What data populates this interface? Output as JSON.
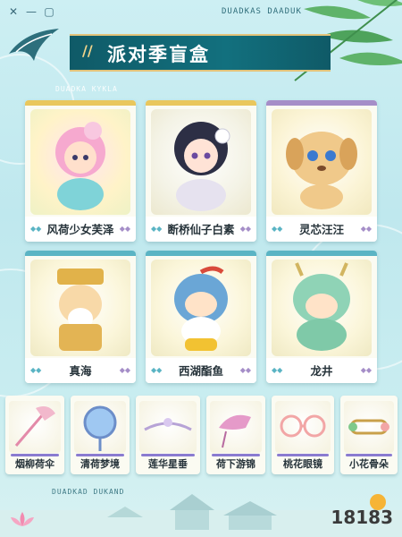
{
  "header": {
    "title": "派对季盲盒",
    "brand_text": "DUADKAS DAADUK",
    "brand_text_small": "DUADKA KYKLA",
    "brand_text_bottom": "DUADKAD DUKAND"
  },
  "featured_items": [
    {
      "name": "风荷少女芙泽",
      "stripe_color": "#e9c75d"
    },
    {
      "name": "断桥仙子白素",
      "stripe_color": "#e9c75d"
    },
    {
      "name": "灵芯汪汪",
      "stripe_color": "#a58ec8"
    },
    {
      "name": "真海",
      "stripe_color": "#5ab4c4"
    },
    {
      "name": "西湖酯鱼",
      "stripe_color": "#5ab4c4"
    },
    {
      "name": "龙井",
      "stripe_color": "#5ab4c4"
    }
  ],
  "accessories": [
    {
      "name": "烟柳荷伞"
    },
    {
      "name": "清荷梦境"
    },
    {
      "name": "莲华星垂"
    },
    {
      "name": "荷下游锦"
    },
    {
      "name": "桃花眼镜"
    },
    {
      "name": "小花骨朵"
    }
  ],
  "watermark": "18183"
}
